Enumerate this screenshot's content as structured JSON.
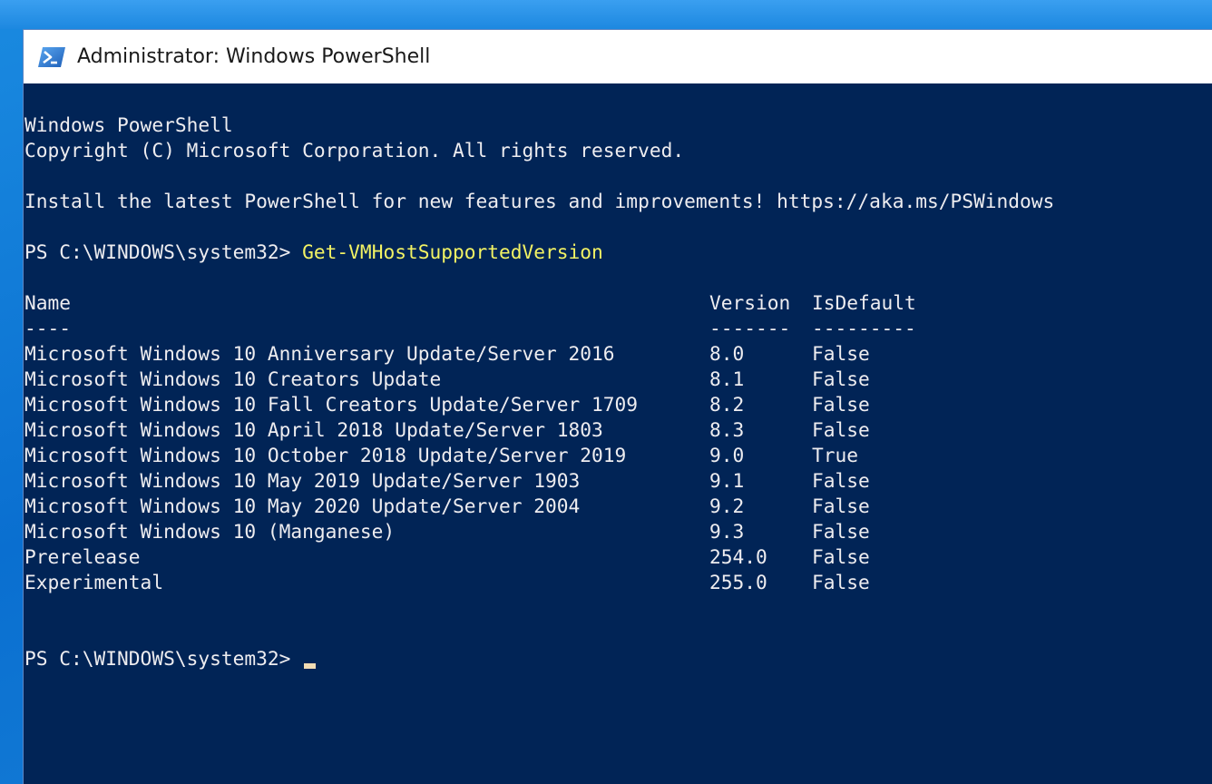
{
  "window": {
    "title": "Administrator: Windows PowerShell",
    "icon": "powershell-icon"
  },
  "console": {
    "banner_line_1": "Windows PowerShell",
    "banner_line_2": "Copyright (C) Microsoft Corporation. All rights reserved.",
    "banner_line_3": "Install the latest PowerShell for new features and improvements! https://aka.ms/PSWindows",
    "prompt": "PS C:\\WINDOWS\\system32> ",
    "command": "Get-VMHostSupportedVersion",
    "table": {
      "headers": {
        "name": "Name",
        "version": "Version",
        "isdefault": "IsDefault"
      },
      "separators": {
        "name": "----",
        "version": "-------",
        "isdefault": "---------"
      },
      "rows": [
        {
          "name": "Microsoft Windows 10 Anniversary Update/Server 2016",
          "version": "8.0",
          "isdefault": "False"
        },
        {
          "name": "Microsoft Windows 10 Creators Update",
          "version": "8.1",
          "isdefault": "False"
        },
        {
          "name": "Microsoft Windows 10 Fall Creators Update/Server 1709",
          "version": "8.2",
          "isdefault": "False"
        },
        {
          "name": "Microsoft Windows 10 April 2018 Update/Server 1803",
          "version": "8.3",
          "isdefault": "False"
        },
        {
          "name": "Microsoft Windows 10 October 2018 Update/Server 2019",
          "version": "9.0",
          "isdefault": "True"
        },
        {
          "name": "Microsoft Windows 10 May 2019 Update/Server 1903",
          "version": "9.1",
          "isdefault": "False"
        },
        {
          "name": "Microsoft Windows 10 May 2020 Update/Server 2004",
          "version": "9.2",
          "isdefault": "False"
        },
        {
          "name": "Microsoft Windows 10 (Manganese)",
          "version": "9.3",
          "isdefault": "False"
        },
        {
          "name": "Prerelease",
          "version": "254.0",
          "isdefault": "False"
        },
        {
          "name": "Experimental",
          "version": "255.0",
          "isdefault": "False"
        }
      ]
    },
    "final_prompt": "PS C:\\WINDOWS\\system32> "
  },
  "colors": {
    "console_background": "#012456",
    "console_text": "#eeedf0",
    "command_text": "#f3f364",
    "cursor": "#f2dcb4",
    "titlebar_background": "#ffffff"
  }
}
